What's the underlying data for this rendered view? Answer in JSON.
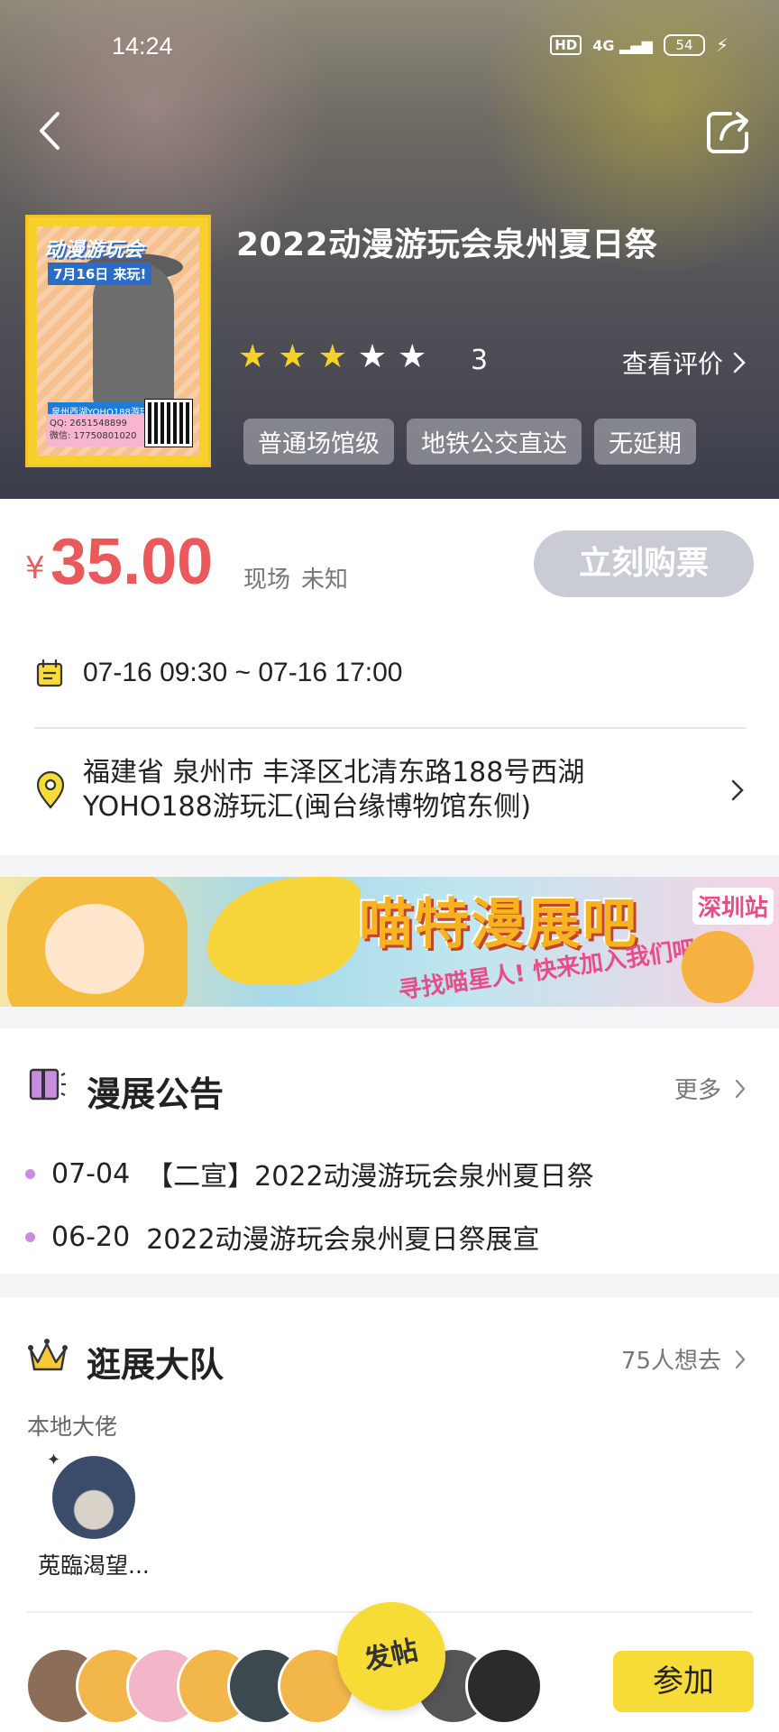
{
  "status_bar": {
    "time": "14:24",
    "hd": "HD",
    "network": "4G",
    "battery": "54"
  },
  "event": {
    "title": "2022动漫游玩会泉州夏日祭",
    "poster": {
      "title": "动漫游玩会",
      "subtitle": "7月16日 来玩!",
      "info_line": "泉州西湖YOHO188游玩汇",
      "contact_qq": "QQ: 2651548899",
      "contact_wechat": "微信: 17750801020"
    },
    "rating": {
      "stars_filled": 3,
      "stars_total": 5,
      "count_label": "3"
    },
    "view_reviews_label": "查看评价",
    "tags": [
      "普通场馆级",
      "地铁公交直达",
      "无延期"
    ]
  },
  "pricing": {
    "currency": "¥",
    "price": "35.00",
    "meta": [
      "现场",
      "未知"
    ],
    "buy_label": "立刻购票"
  },
  "schedule": {
    "datetime": "07-16 09:30 ~ 07-16 17:00"
  },
  "location": {
    "address": "福建省 泉州市 丰泽区北清东路188号西湖YOHO188游玩汇(闽台缘博物馆东侧)"
  },
  "banner": {
    "title": "喵特漫展吧",
    "station": "深圳站",
    "slogan": "寻找喵星人! 快来加入我们吧!"
  },
  "announcements": {
    "title": "漫展公告",
    "more_label": "更多",
    "items": [
      {
        "date": "07-04",
        "text": "【二宣】2022动漫游玩会泉州夏日祭"
      },
      {
        "date": "06-20",
        "text": "2022动漫游玩会泉州夏日祭展宣"
      }
    ]
  },
  "team": {
    "title": "逛展大队",
    "want_label": "75人想去",
    "local_label": "本地大佬",
    "local_user": {
      "name": "莵臨渴望..."
    },
    "post_label": "发帖",
    "join_label": "参加"
  },
  "colors": {
    "accent_price": "#ea5a5c",
    "star_on": "#f6d12a",
    "buy_disabled": "#c9ccd5",
    "join_yellow": "#f7dc38",
    "dot_purple": "#c98de0"
  }
}
